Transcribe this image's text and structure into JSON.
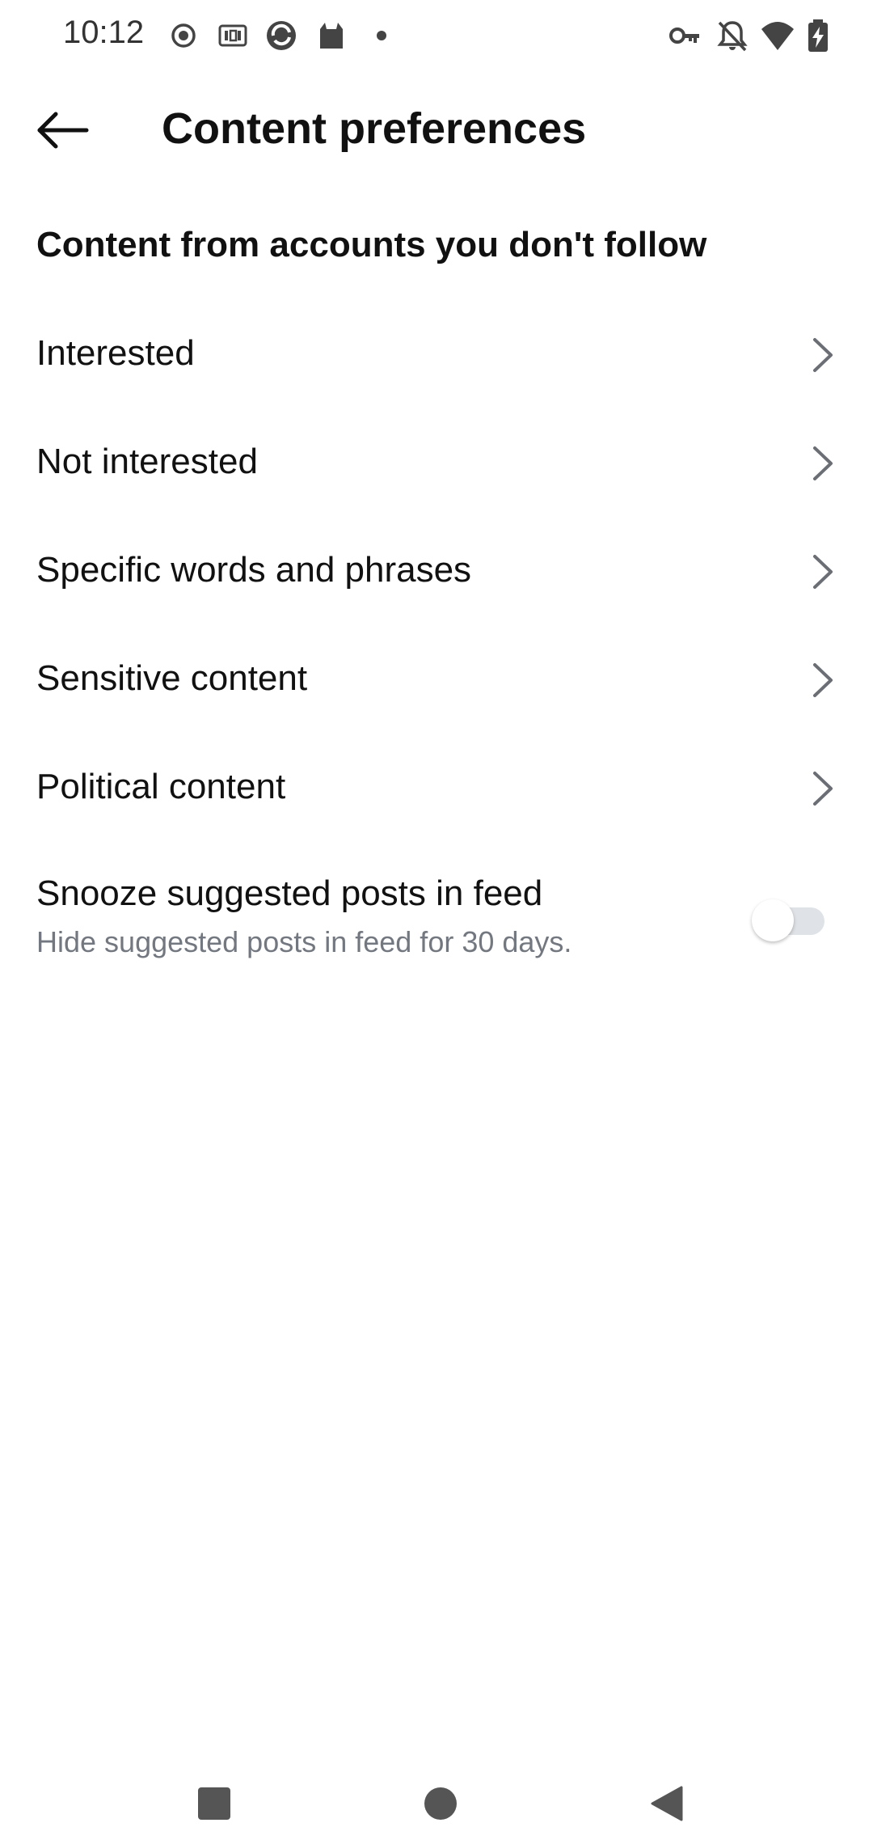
{
  "status_bar": {
    "time": "10:12",
    "left_icons": [
      "record-icon",
      "iqiyi-icon",
      "app-swirl-icon",
      "cat-icon",
      "dot-icon"
    ],
    "right_icons": [
      "vpn-key-icon",
      "notifications-off-icon",
      "wifi-icon",
      "battery-charging-icon"
    ]
  },
  "header": {
    "back_icon": "arrow-left-icon",
    "title": "Content preferences"
  },
  "section": {
    "heading": "Content from accounts you don't follow"
  },
  "menu_items": [
    {
      "label": "Interested"
    },
    {
      "label": "Not interested"
    },
    {
      "label": "Specific words and phrases"
    },
    {
      "label": "Sensitive content"
    },
    {
      "label": "Political content"
    }
  ],
  "snooze": {
    "title": "Snooze suggested posts in feed",
    "subtitle": "Hide suggested posts in feed for 30 days.",
    "enabled": false
  },
  "nav_bar": {
    "icons": [
      "recents-square-icon",
      "home-circle-icon",
      "back-triangle-icon"
    ]
  },
  "colors": {
    "text": "#111111",
    "subtext": "#737880",
    "chevron": "#6b6f75",
    "toggle_track": "#dfe2e6"
  }
}
